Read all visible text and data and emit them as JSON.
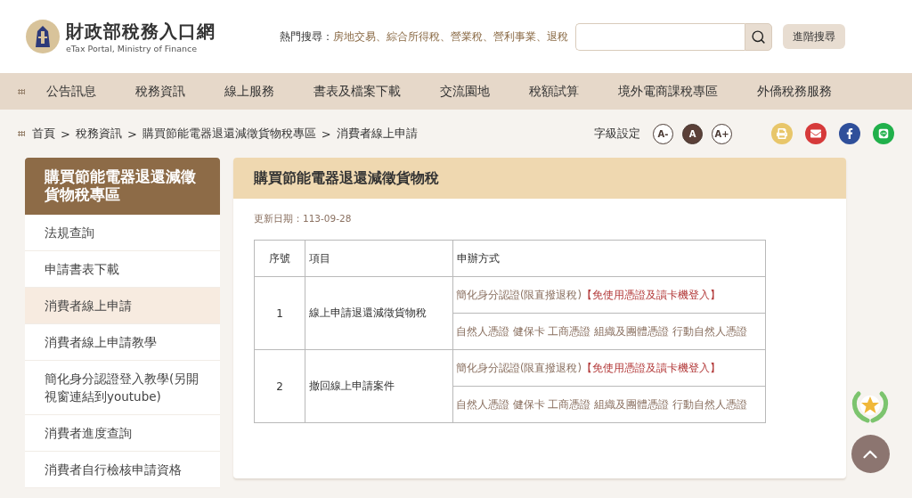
{
  "header": {
    "site_title": "財政部稅務入口網",
    "site_subtitle": "eTax Portal, Ministry of Finance",
    "hot_search_label": "熱門搜尋：",
    "hot_search_separator": "、",
    "hot_searches": [
      "房地交易",
      "綜合所得稅",
      "營業稅",
      "營利事業",
      "退稅"
    ],
    "advanced_search": "進階搜尋"
  },
  "nav": [
    "公告訊息",
    "稅務資訊",
    "線上服務",
    "書表及檔案下載",
    "交流園地",
    "稅額試算",
    "境外電商課稅專區",
    "外僑稅務服務"
  ],
  "breadcrumb": {
    "separator": ">",
    "items": [
      "首頁",
      "稅務資訊",
      "購買節能電器退還減徵貨物稅專區",
      "消費者線上申請"
    ]
  },
  "font_size": {
    "label": "字級設定",
    "options": [
      {
        "label": "A-",
        "selected": false
      },
      {
        "label": "A",
        "selected": true
      },
      {
        "label": "A+",
        "selected": false
      }
    ]
  },
  "share": [
    {
      "kind": "print"
    },
    {
      "kind": "mail"
    },
    {
      "kind": "facebook"
    },
    {
      "kind": "line"
    }
  ],
  "sidebar": {
    "title": "購買節能電器退還減徵貨物稅專區",
    "items": [
      {
        "label": "法規查詢",
        "selected": false
      },
      {
        "label": "申請書表下載",
        "selected": false
      },
      {
        "label": "消費者線上申請",
        "selected": true
      },
      {
        "label": "消費者線上申請教學",
        "selected": false
      },
      {
        "label": "簡化身分認證登入教學(另開視窗連結到youtube)",
        "selected": false
      },
      {
        "label": "消費者進度查詢",
        "selected": false
      },
      {
        "label": "消費者自行檢核申請資格",
        "selected": false
      }
    ]
  },
  "main": {
    "title": "購買節能電器退還減徵貨物稅",
    "updated": "更新日期：113-09-28",
    "table": {
      "columns": [
        "序號",
        "項目",
        "申辦方式"
      ],
      "rows": [
        {
          "no": "1",
          "item": "線上申請退還減徵貨物稅",
          "methods": [
            {
              "text": "簡化身分認證(限直撥退稅)",
              "highlight": "【免使用憑證及讀卡機登入】"
            },
            {
              "text": "自然人憑證 健保卡 工商憑證 組織及團體憑證 行動自然人憑證"
            }
          ]
        },
        {
          "no": "2",
          "item": "撤回線上申請案件",
          "methods": [
            {
              "text": "簡化身分認證(限直撥退稅)",
              "highlight": "【免使用憑證及讀卡機登入】"
            },
            {
              "text": "自然人憑證 健保卡 工商憑證 組織及團體憑證 行動自然人憑證"
            }
          ]
        }
      ]
    }
  }
}
